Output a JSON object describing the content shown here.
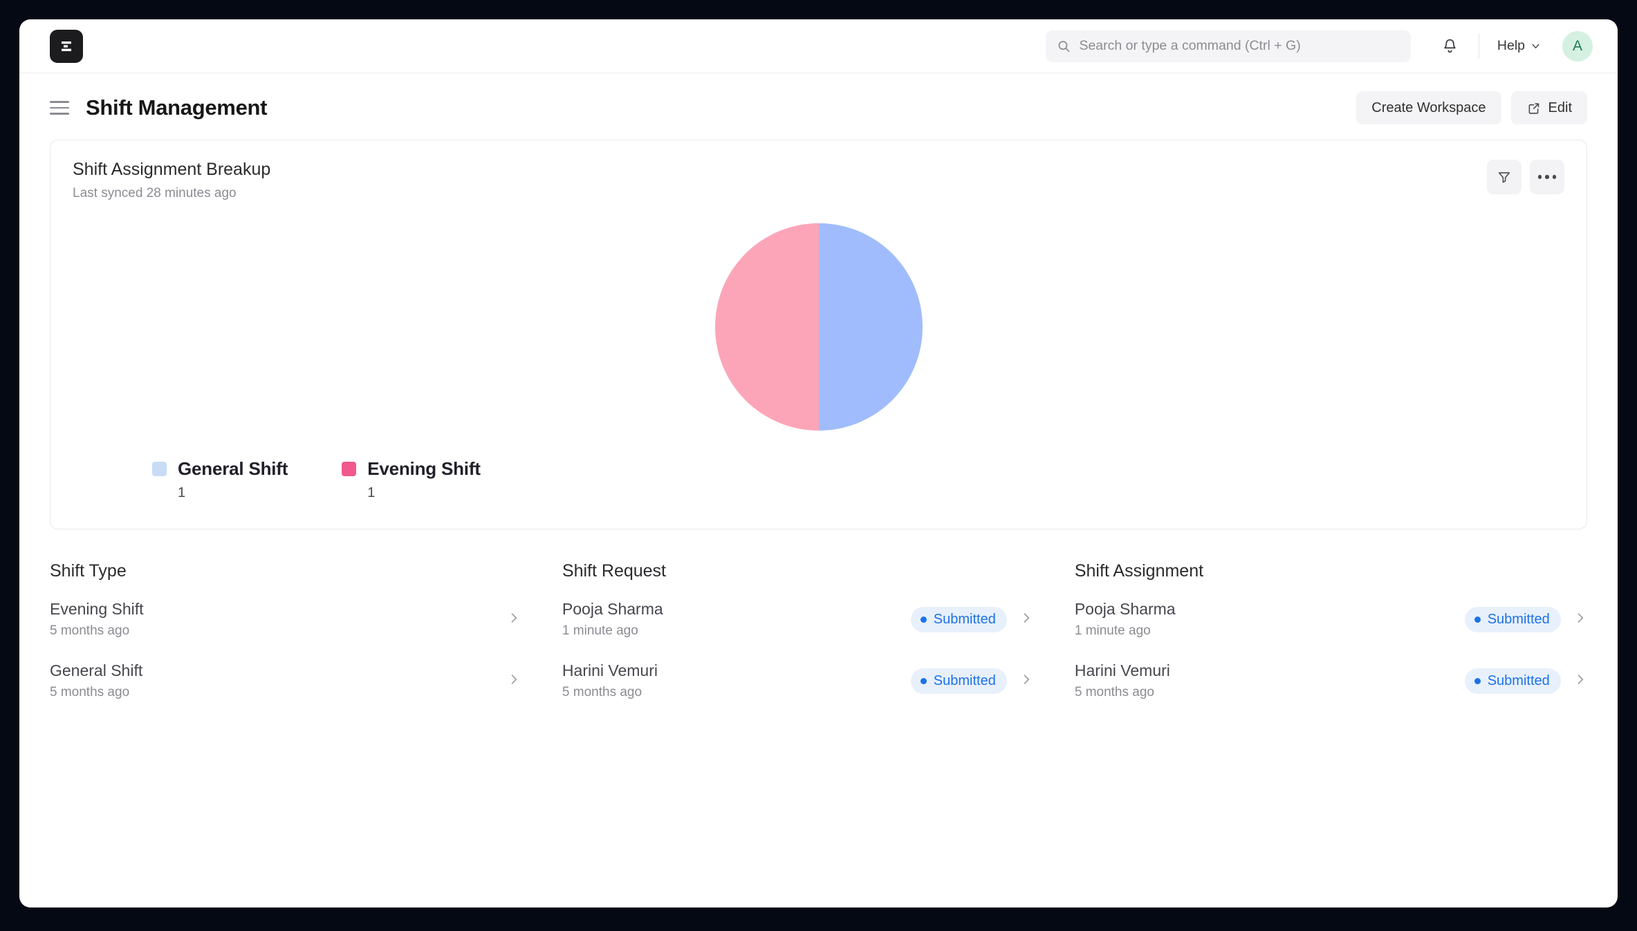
{
  "navbar": {
    "logo_alt": "frappe-logo",
    "search": {
      "placeholder": "Search or type a command (Ctrl + G)",
      "value": ""
    },
    "notifications_icon": "bell-icon",
    "help_label": "Help",
    "avatar_initial": "A"
  },
  "page": {
    "title": "Shift Management",
    "actions": {
      "create_workspace": "Create Workspace",
      "edit": "Edit"
    }
  },
  "card": {
    "title": "Shift Assignment Breakup",
    "subtitle": "Last synced 28 minutes ago",
    "filter_icon": "filter-icon",
    "more_icon": "ellipsis-icon"
  },
  "chart_data": {
    "type": "pie",
    "title": "Shift Assignment Breakup",
    "subtitle": "Last synced 28 minutes ago",
    "labels": [
      "General Shift",
      "Evening Shift"
    ],
    "values": [
      1,
      1
    ],
    "percentages": [
      50,
      50
    ],
    "slice_colors": [
      "#a0bcfc",
      "#fca5b8"
    ],
    "legend_colors": [
      "#c8dcf6",
      "#f1588e"
    ],
    "legend_position": "bottom-left",
    "grid": false
  },
  "columns": [
    {
      "title": "Shift Type",
      "rows": [
        {
          "title": "Evening Shift",
          "subtitle": "5 months ago",
          "status": null,
          "chevron": "chevron-right-icon"
        },
        {
          "title": "General Shift",
          "subtitle": "5 months ago",
          "status": null,
          "chevron": "chevron-right-icon"
        }
      ]
    },
    {
      "title": "Shift Request",
      "rows": [
        {
          "title": "Pooja Sharma",
          "subtitle": "1 minute ago",
          "status": "Submitted",
          "chevron": "chevron-right-icon"
        },
        {
          "title": "Harini Vemuri",
          "subtitle": "5 months ago",
          "status": "Submitted",
          "chevron": "chevron-right-icon"
        }
      ]
    },
    {
      "title": "Shift Assignment",
      "rows": [
        {
          "title": "Pooja Sharma",
          "subtitle": "1 minute ago",
          "status": "Submitted",
          "chevron": "chevron-right-icon"
        },
        {
          "title": "Harini Vemuri",
          "subtitle": "5 months ago",
          "status": "Submitted",
          "chevron": "chevron-right-icon"
        }
      ]
    }
  ],
  "theme": {
    "status_blue": "#1b72e8",
    "status_blue_bg": "#e8f0fb",
    "avatar_bg": "#d4f0e0",
    "desktop_bg": "#050914"
  }
}
